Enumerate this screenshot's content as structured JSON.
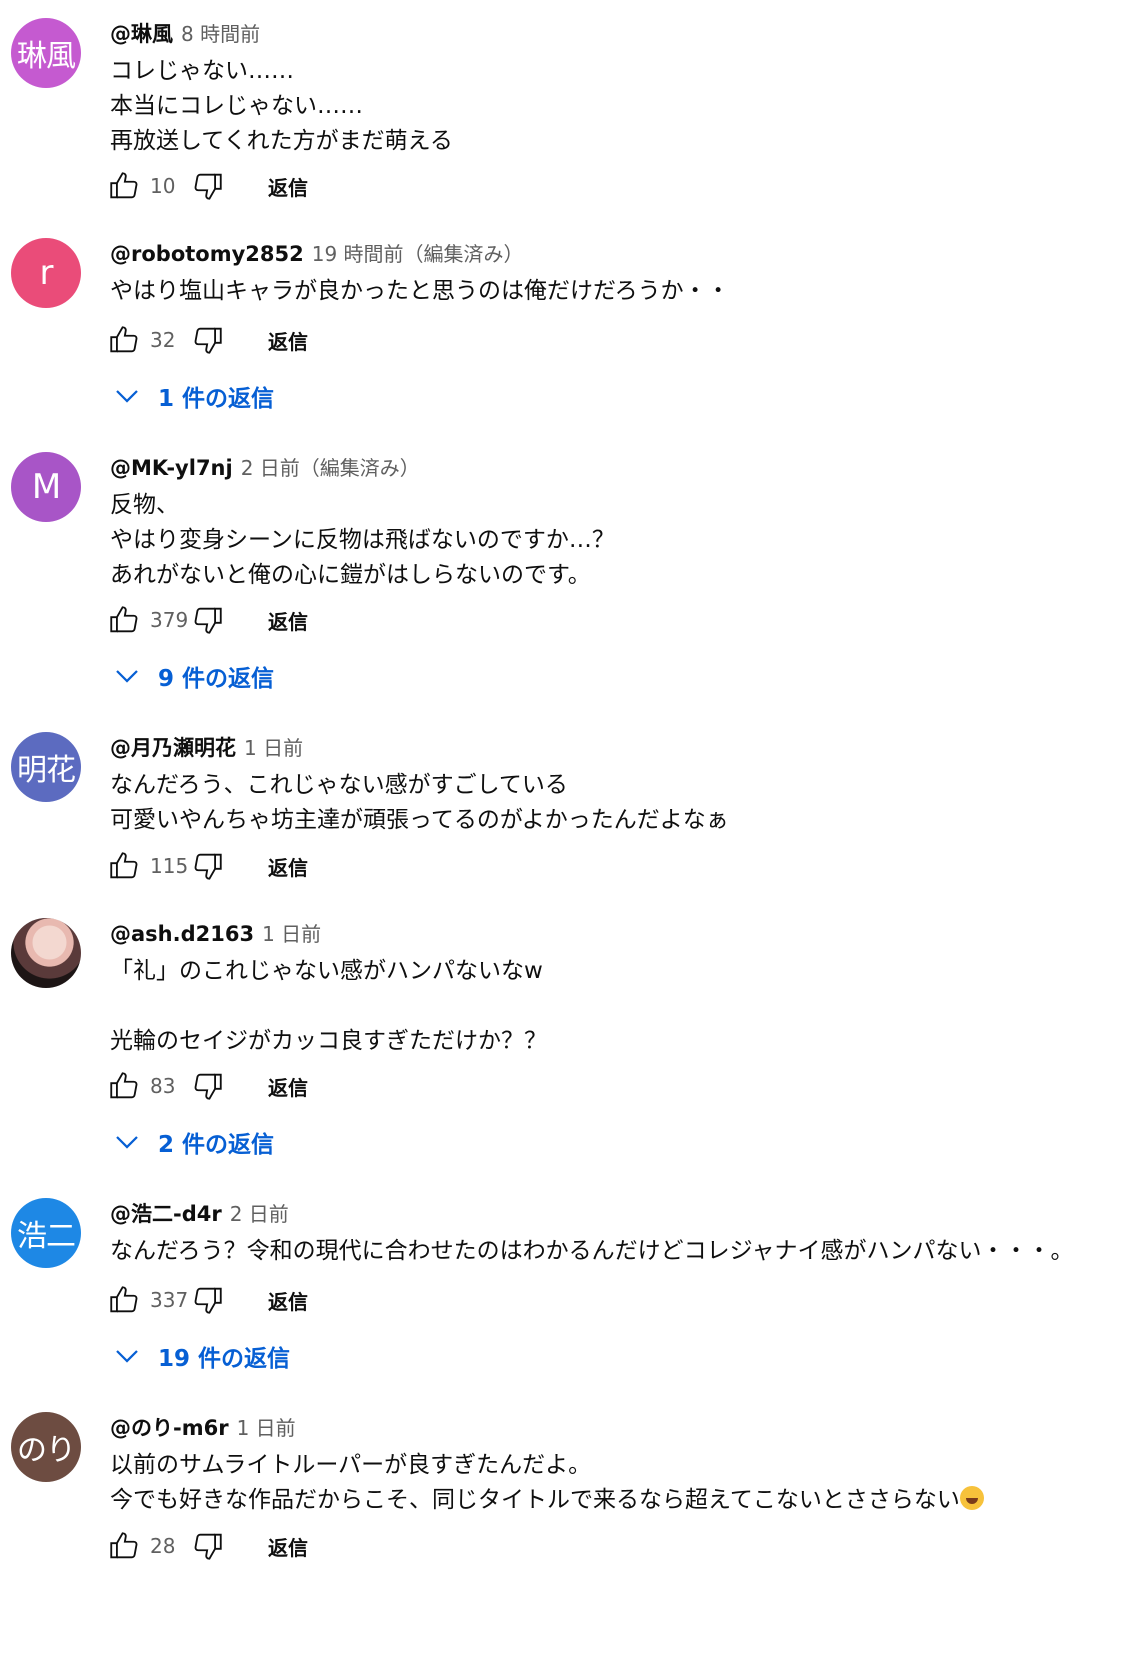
{
  "ui": {
    "reply_label": "返信",
    "emoji_name": "tears-of-joy-emoji"
  },
  "comments": [
    {
      "author": "@琳風",
      "time": "8 時間前",
      "avatar_text": "琳風",
      "avatar_color": "#c55ad0",
      "text": "コレじゃない……\n本当にコレじゃない……\n再放送してくれた方がまだ萌える",
      "likes": "10",
      "replies": ""
    },
    {
      "author": "@robotomy2852",
      "time": "19 時間前（編集済み）",
      "avatar_text": "r",
      "avatar_color": "#ea4c79",
      "text": "やはり塩山キャラが良かったと思うのは俺だけだろうか・・",
      "likes": "32",
      "replies": "1 件の返信"
    },
    {
      "author": "@MK-yl7nj",
      "time": "2 日前（編集済み）",
      "avatar_text": "M",
      "avatar_color": "#a855c7",
      "text": "反物、\nやはり変身シーンに反物は飛ばないのですか…？\nあれがないと俺の心に鎧がはしらないのです。",
      "likes": "379",
      "replies": "9 件の返信"
    },
    {
      "author": "@月乃瀬明花",
      "time": "1 日前",
      "avatar_text": "明花",
      "avatar_color": "#5c6bc0",
      "text": "なんだろう、これじゃない感がすごしている\n可愛いやんちゃ坊主達が頑張ってるのがよかったんだよなぁ",
      "likes": "115",
      "replies": ""
    },
    {
      "author": "@ash.d2163",
      "time": "1 日前",
      "avatar_text": "",
      "avatar_color": "#3a2a2a",
      "text": "「礼」のこれじゃない感がハンパないなw\n\n光輪のセイジがカッコ良すぎただけか？？",
      "likes": "83",
      "replies": "2 件の返信"
    },
    {
      "author": "@浩二-d4r",
      "time": "2 日前",
      "avatar_text": "浩二",
      "avatar_color": "#1e88e5",
      "text": "なんだろう？令和の現代に合わせたのはわかるんだけどコレジャナイ感がハンパない・・・。",
      "likes": "337",
      "replies": "19 件の返信"
    },
    {
      "author": "@のり-m6r",
      "time": "1 日前",
      "avatar_text": "のり",
      "avatar_color": "#6d4c41",
      "text": "以前のサムライトルーパーが良すぎたんだよ。\n今でも好きな作品だからこそ、同じタイトルで来るなら超えてこないとささらない",
      "likes": "28",
      "replies": ""
    }
  ]
}
